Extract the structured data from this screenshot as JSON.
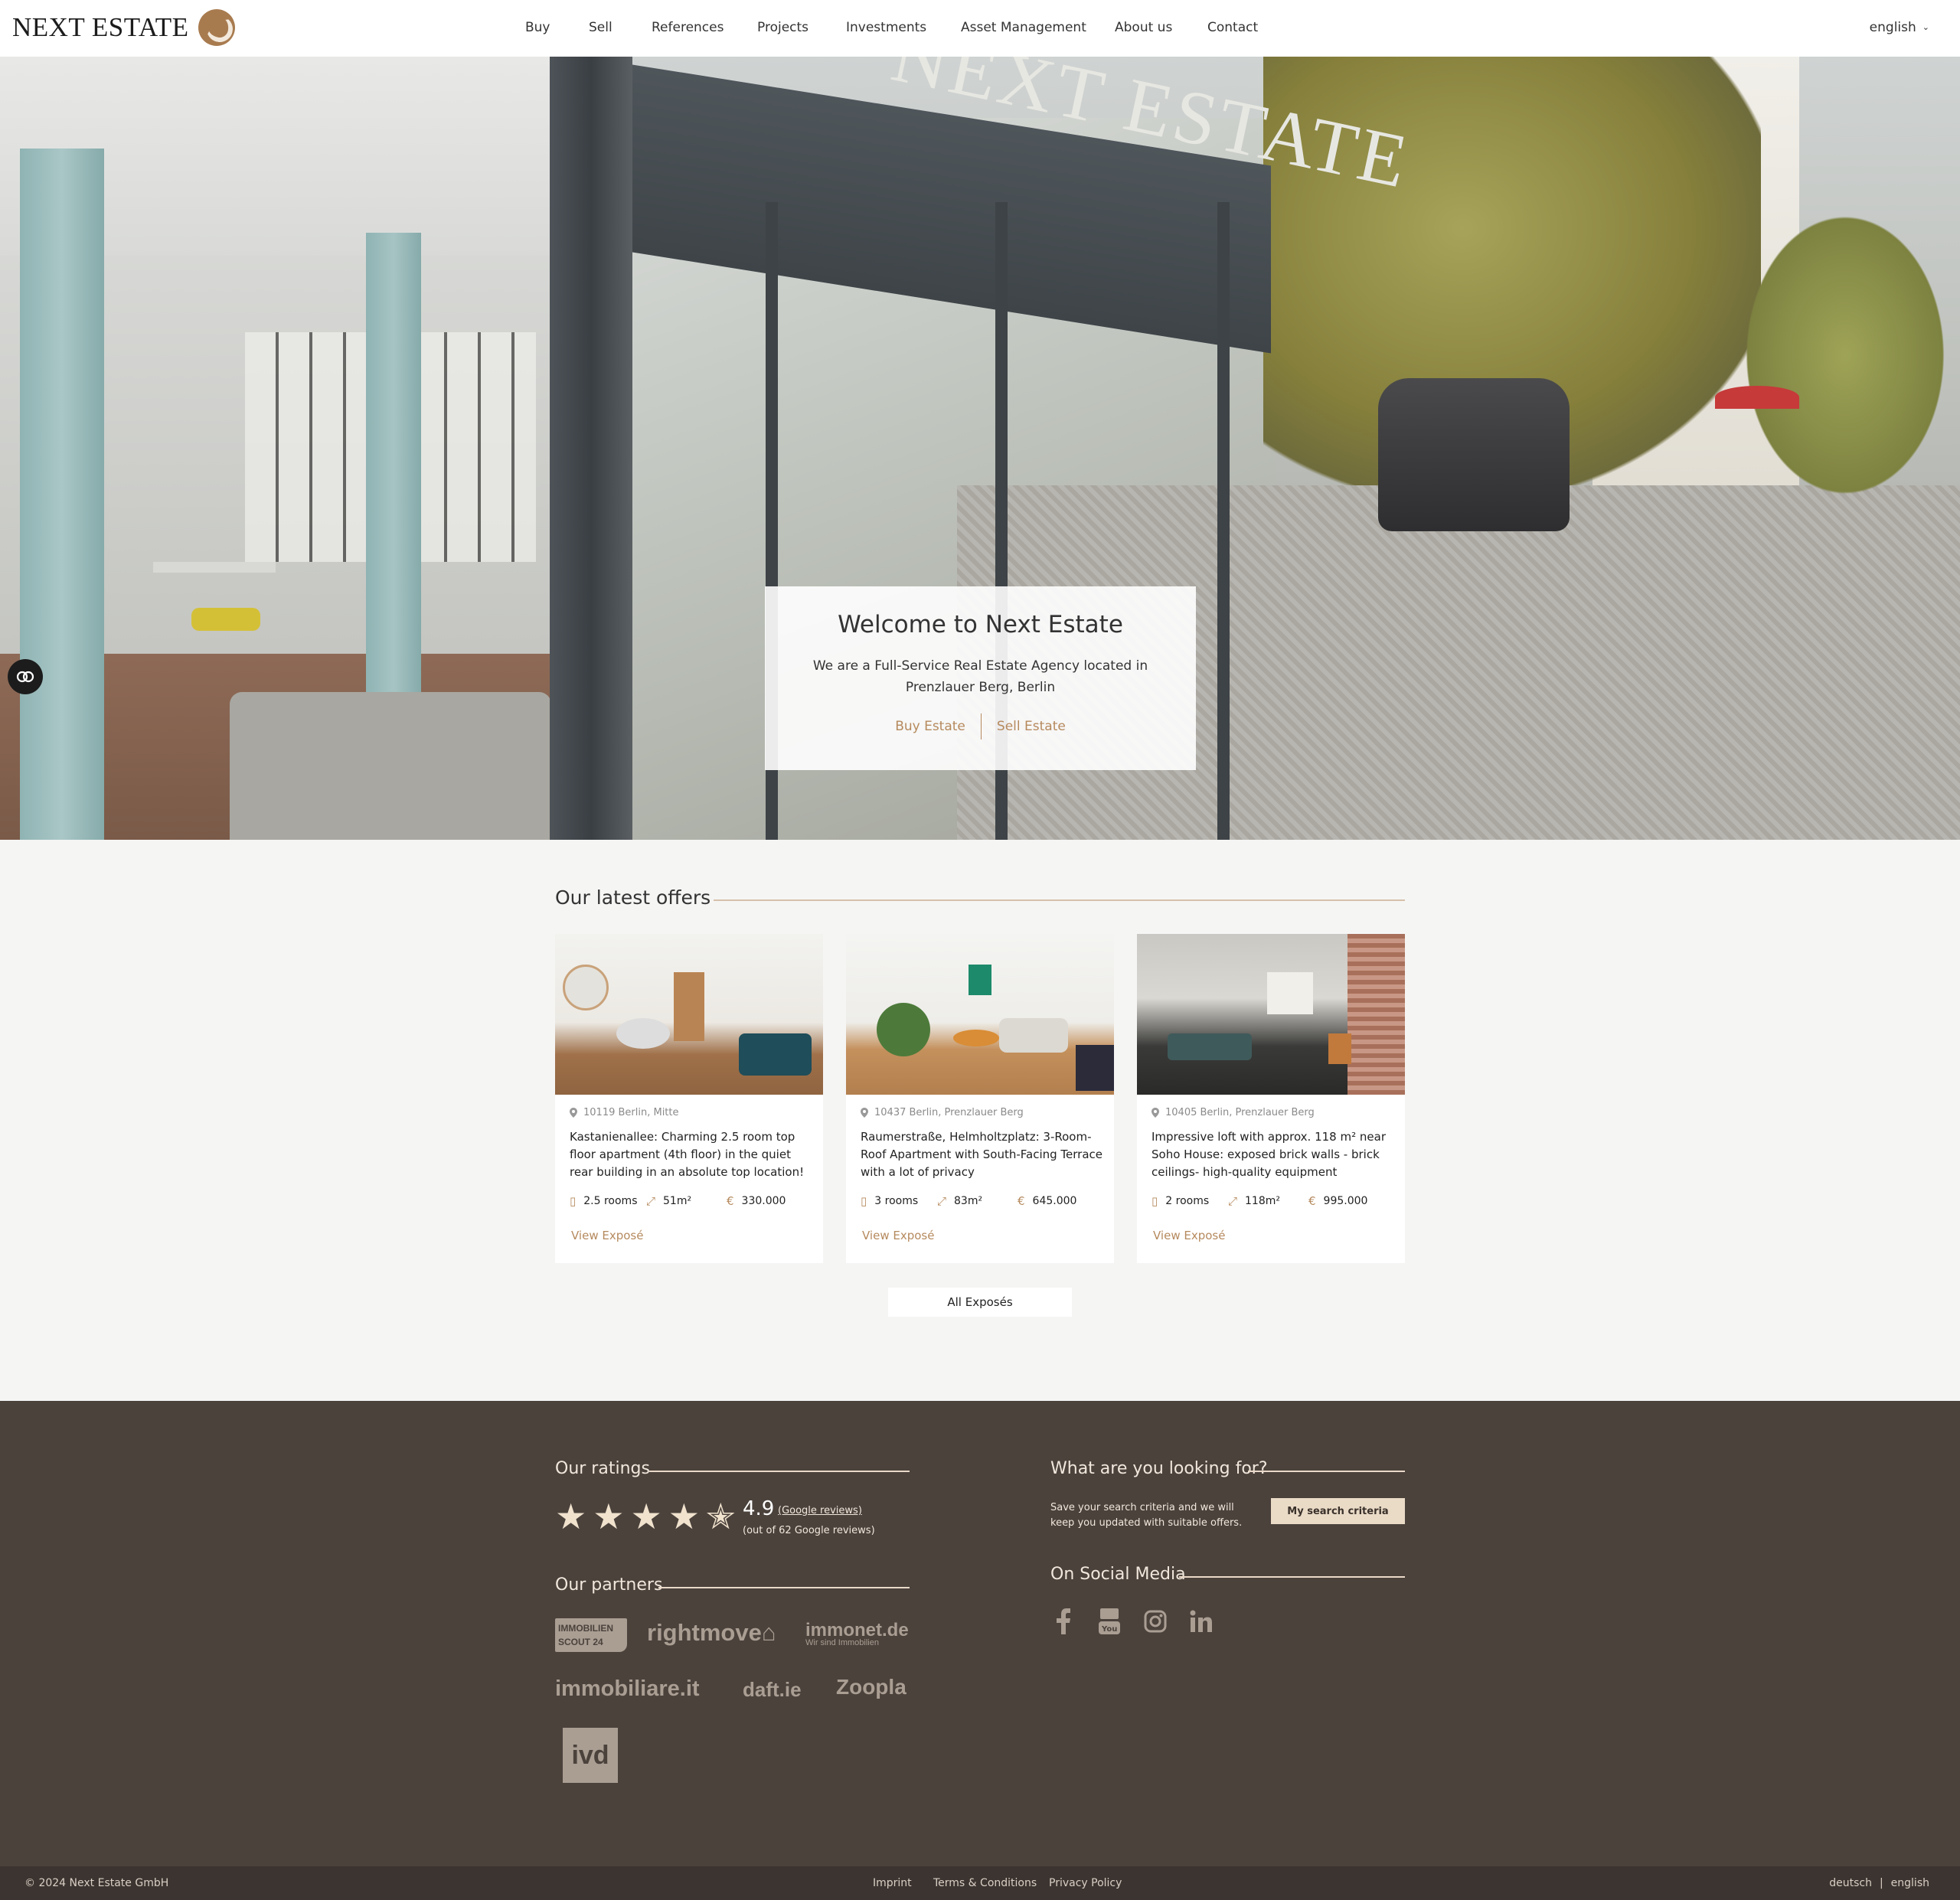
{
  "header": {
    "logo_text": "NEXT ESTATE",
    "nav": [
      "Buy",
      "Sell",
      "References",
      "Projects",
      "Investments",
      "Asset Management",
      "About us",
      "Contact"
    ],
    "language": "english"
  },
  "hero": {
    "title": "Welcome to Next Estate",
    "subtitle": "We are a Full-Service Real Estate Agency located in Prenzlauer Berg, Berlin",
    "buy_label": "Buy Estate",
    "sell_label": "Sell Estate",
    "sign_text": "NEXT ESTATE"
  },
  "offers": {
    "title": "Our latest offers",
    "all_label": "All Exposés",
    "cards": [
      {
        "location": "10119 Berlin, Mitte",
        "title": "Kastanienallee: Charming 2.5 room top floor apartment (4th floor) in the quiet rear building in an absolute top location!",
        "rooms": "2.5 rooms",
        "area": "51m²",
        "price": "330.000",
        "view_label": "View Exposé"
      },
      {
        "location": "10437 Berlin, Prenzlauer Berg",
        "title": "Raumerstraße, Helmholtzplatz: 3-Room-Roof Apartment with South-Facing Terrace with a lot of privacy",
        "rooms": "3 rooms",
        "area": "83m²",
        "price": "645.000",
        "view_label": "View Exposé"
      },
      {
        "location": "10405 Berlin, Prenzlauer Berg",
        "title": "Impressive loft with approx. 118 m² near Soho House: exposed brick walls - brick ceilings- high-quality equipment",
        "rooms": "2 rooms",
        "area": "118m²",
        "price": "995.000",
        "view_label": "View Exposé"
      }
    ]
  },
  "footer": {
    "ratings_title": "Our ratings",
    "rating_value": "4.9",
    "rating_link": "(Google reviews)",
    "rating_sub": "(out of 62 Google reviews)",
    "stars": 4.5,
    "partners_title": "Our partners",
    "partners": {
      "scout_line1": "IMMOBILIEN",
      "scout_line2": "SCOUT 24",
      "rightmove": "rightmove",
      "immonet": "immonet.de",
      "immonet_tagline": "Wir sind Immobilien",
      "immobiliare": "immobiliare.it",
      "daft": "daft.ie",
      "zoopla": "Zoopla",
      "ivd": "ivd"
    },
    "search_title": "What are you looking for?",
    "search_text": "Save your search criteria and we will keep you updated with suitable offers.",
    "search_button": "My search criteria",
    "social_title": "On Social Media",
    "social_icons": [
      "facebook-icon",
      "youtube-icon",
      "instagram-icon",
      "linkedin-icon"
    ]
  },
  "bottom": {
    "copyright": "© 2024 Next Estate GmbH",
    "imprint": "Imprint",
    "terms": "Terms & Conditions",
    "privacy": "Privacy Policy",
    "lang_de": "deutsch",
    "lang_en": "english"
  },
  "colors": {
    "accent": "#b68a5e",
    "footer_bg": "#4b423c",
    "bottom_bar": "#3c3430",
    "offers_bg": "#f5f5f4"
  }
}
